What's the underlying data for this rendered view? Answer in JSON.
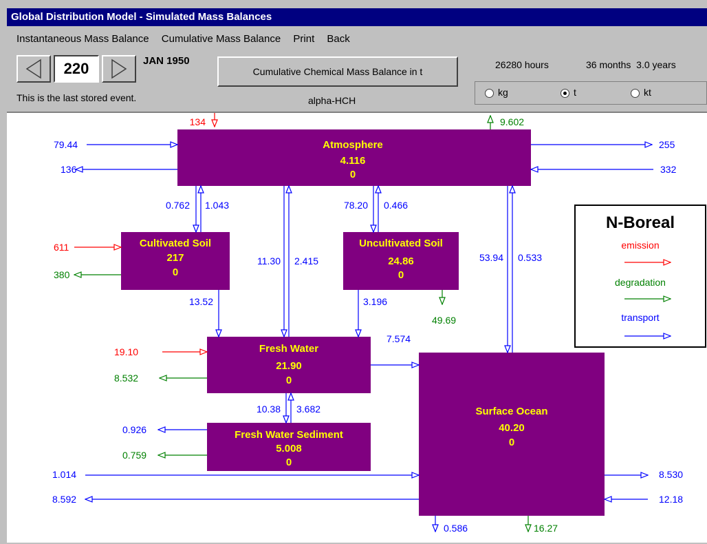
{
  "window": {
    "title": "Global Distribution Model - Simulated Mass Balances"
  },
  "menu": {
    "items": [
      "Instantaneous Mass Balance",
      "Cumulative Mass Balance",
      "Print",
      "Back"
    ]
  },
  "controls": {
    "event_number": "220",
    "date": "JAN 1950",
    "mode_button": "Cumulative Chemical Mass Balance in t",
    "status": "This is the last stored event.",
    "chemical": "alpha-HCH",
    "hours": "26280 hours",
    "months_years": "36 months  3.0 years",
    "units": [
      {
        "label": "kg",
        "selected": false
      },
      {
        "label": "t",
        "selected": true
      },
      {
        "label": "kt",
        "selected": false
      }
    ]
  },
  "compartments": {
    "atmosphere": {
      "name": "Atmosphere",
      "value": "4.116",
      "sub": "0"
    },
    "cultivated_soil": {
      "name": "Cultivated Soil",
      "value": "217",
      "sub": "0"
    },
    "uncultivated_soil": {
      "name": "Uncultivated Soil",
      "value": "24.86",
      "sub": "0"
    },
    "fresh_water": {
      "name": "Fresh Water",
      "value": "21.90",
      "sub": "0"
    },
    "fw_sediment": {
      "name": "Fresh Water Sediment",
      "value": "5.008",
      "sub": "0"
    },
    "surface_ocean": {
      "name": "Surface Ocean",
      "value": "40.20",
      "sub": "0"
    }
  },
  "flows": {
    "atm_emission": "134",
    "atm_degradation": "9.602",
    "atm_in_left": "79.44",
    "atm_out_left": "136",
    "atm_out_right": "255",
    "atm_in_right": "332",
    "atm_to_cult": "0.762",
    "cult_to_atm": "1.043",
    "atm_to_fw": "11.30",
    "fw_to_atm": "2.415",
    "atm_to_uncult": "78.20",
    "uncult_to_atm": "0.466",
    "atm_to_ocean": "53.94",
    "ocean_to_atm": "0.533",
    "cult_emission": "611",
    "cult_degradation": "380",
    "cult_to_fw": "13.52",
    "uncult_to_fw": "3.196",
    "uncult_degradation": "49.69",
    "fw_emission": "19.10",
    "fw_degradation": "8.532",
    "fw_to_ocean": "7.574",
    "fw_to_sed": "10.38",
    "sed_to_fw": "3.682",
    "sed_transport": "0.926",
    "sed_degradation": "0.759",
    "ocean_in_left": "1.014",
    "ocean_out_left": "8.592",
    "ocean_out_right": "8.530",
    "ocean_in_right": "12.18",
    "ocean_sink": "0.586",
    "ocean_degradation": "16.27"
  },
  "legend": {
    "title": "N-Boreal",
    "emission": "emission",
    "degradation": "degradation",
    "transport": "transport"
  },
  "colors": {
    "box": "#800080",
    "box_text": "#ffff00",
    "transport": "#0000ff",
    "emission": "#ff0000",
    "degradation": "#008000"
  }
}
